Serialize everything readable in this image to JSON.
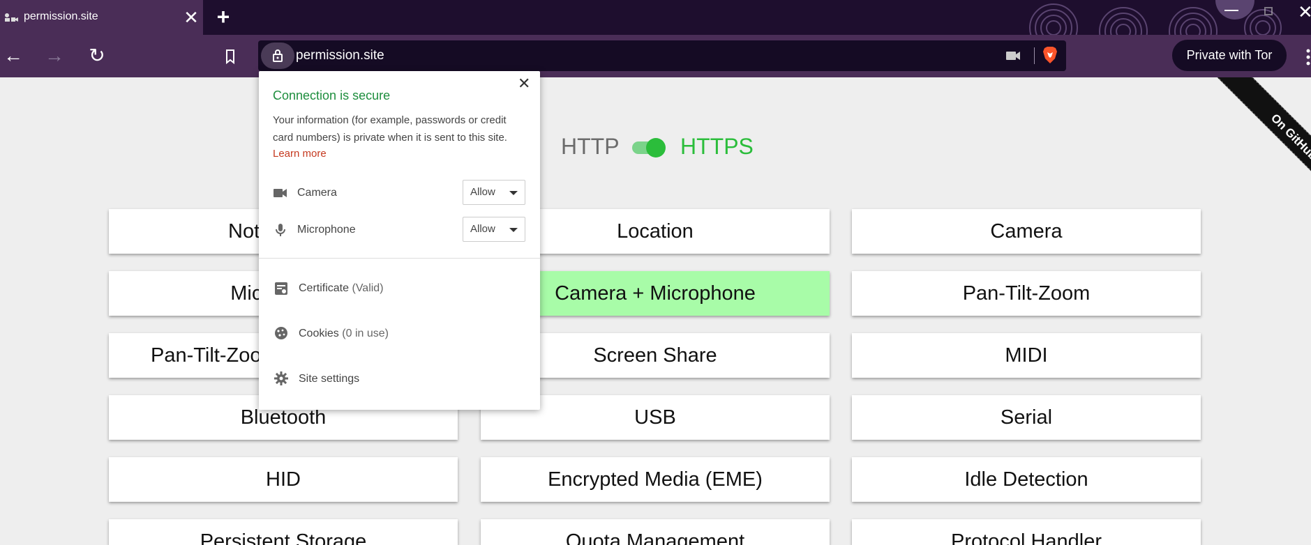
{
  "tab": {
    "title": "permission.site",
    "close": "✕"
  },
  "toolbar": {
    "new_tab": "+",
    "back": "←",
    "forward": "→",
    "reload": "↻",
    "url": "permission.site",
    "tor_button": "Private with Tor"
  },
  "page": {
    "http_label": "HTTP",
    "https_label": "HTTPS",
    "ribbon": "On GitHub",
    "buttons": [
      [
        "Notifications",
        "Location",
        "Camera"
      ],
      [
        "Microphone",
        "Camera + Microphone",
        "Pan-Tilt-Zoom"
      ],
      [
        "Pan-Tilt-Zoom + Camera",
        "Screen Share",
        "MIDI"
      ],
      [
        "Bluetooth",
        "USB",
        "Serial"
      ],
      [
        "HID",
        "Encrypted Media (EME)",
        "Idle Detection"
      ],
      [
        "Persistent Storage",
        "Quota Management",
        "Protocol Handler"
      ]
    ],
    "active_button": "Camera + Microphone"
  },
  "popup": {
    "title": "Connection is secure",
    "close": "✕",
    "description": "Your information (for example, passwords or credit card numbers) is private when it is sent to this site.",
    "learn_more": "Learn more",
    "permissions": [
      {
        "label": "Camera",
        "value": "Allow",
        "icon": "camera-icon"
      },
      {
        "label": "Microphone",
        "value": "Allow",
        "icon": "microphone-icon"
      }
    ],
    "certificate_label": "Certificate",
    "certificate_status": "(Valid)",
    "cookies_label": "Cookies",
    "cookies_status": "(0 in use)",
    "site_settings": "Site settings"
  },
  "colors": {
    "secure": "#1e8e3e",
    "https": "#2bbd3b",
    "active_button": "#a8fca8",
    "toolbar": "#4a2d57",
    "tabstrip": "#1e0e2e"
  }
}
